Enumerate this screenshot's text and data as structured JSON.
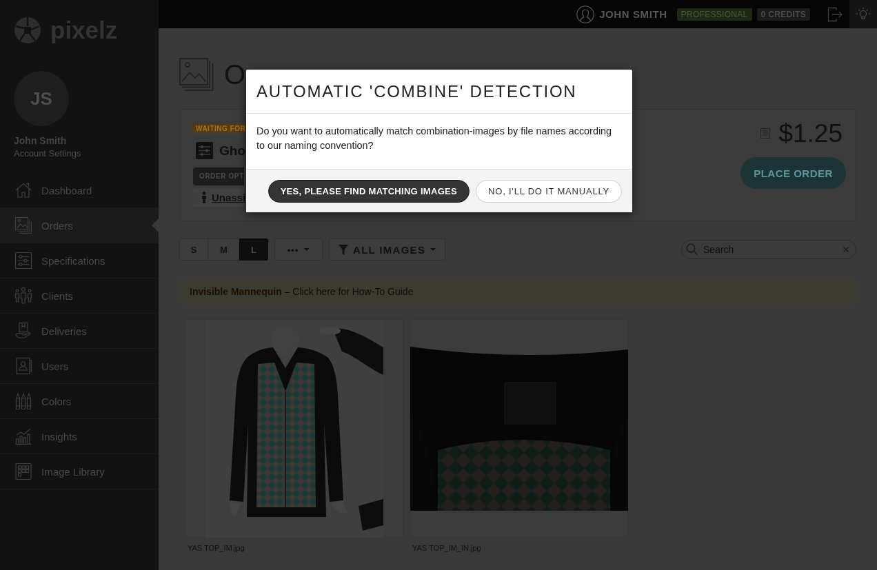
{
  "sidebar": {
    "logo": "pixelz",
    "user": {
      "initials": "JS",
      "name": "John Smith",
      "settings": "Account Settings"
    },
    "nav": [
      {
        "label": "Dashboard",
        "selected": false
      },
      {
        "label": "Orders",
        "selected": true
      },
      {
        "label": "Specifications",
        "selected": false
      },
      {
        "label": "Clients",
        "selected": false
      },
      {
        "label": "Deliveries",
        "selected": false
      },
      {
        "label": "Users",
        "selected": false
      },
      {
        "label": "Colors",
        "selected": false
      },
      {
        "label": "Insights",
        "selected": false
      },
      {
        "label": "Image Library",
        "selected": false
      }
    ]
  },
  "topbar": {
    "user": "JOHN SMITH",
    "plan": "PROFESSIONAL",
    "credits": "0 CREDITS"
  },
  "page": {
    "title": "O"
  },
  "order": {
    "status": "WAITING FOR",
    "name": "Gho",
    "options_tab": "ORDER OPT",
    "assignee": "Unassi",
    "price": "$1.25",
    "place_order": "PLACE ORDER"
  },
  "toolbar": {
    "sizes": [
      {
        "label": "S",
        "selected": false
      },
      {
        "label": "M",
        "selected": false
      },
      {
        "label": "L",
        "selected": true
      }
    ],
    "more": "•••",
    "filter": "ALL IMAGES",
    "search": {
      "placeholder": "Search"
    }
  },
  "banner": {
    "text": "**Invisible Mannequin** – Click here for How-To Guide"
  },
  "images": [
    {
      "kind": "front",
      "filename": "YAS TOP_IM.jpg"
    },
    {
      "kind": "inside",
      "filename": "YAS TOP_IM_IN.jpg"
    }
  ],
  "modal": {
    "title": "AUTOMATIC 'COMBINE' DETECTION",
    "message": "Do you want to automatically match combination-images by file names according to our naming convention?",
    "buttons": [
      {
        "kind": "primary",
        "label": "YES, PLEASE FIND MATCHING IMAGES"
      },
      {
        "kind": "secondary",
        "label": "NO, I'LL DO IT MANUALLY"
      }
    ]
  }
}
